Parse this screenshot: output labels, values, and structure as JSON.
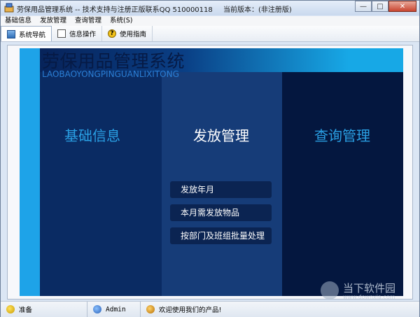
{
  "window": {
    "title": "劳保用品管理系统 -- 技术支持与注册正版联系QQ 510000118",
    "version": "当前版本：(非注册版)",
    "buttons": {
      "minimize": "—",
      "maximize": "□",
      "close": "✕"
    }
  },
  "menubar": {
    "items": [
      "基础信息",
      "发放管理",
      "查询管理",
      "系统(S)"
    ]
  },
  "toolbar": {
    "items": [
      {
        "label": "系统导航",
        "icon": "nav-icon"
      },
      {
        "label": "信息操作",
        "icon": "document-icon"
      },
      {
        "label": "使用指南",
        "icon": "help-icon"
      }
    ]
  },
  "main": {
    "brand_title": "劳保用品管理系统",
    "brand_subtitle": "LAOBAOYONGPINGUANLIXITONG",
    "columns": [
      {
        "title": "基础信息"
      },
      {
        "title": "发放管理"
      },
      {
        "title": "查询管理"
      }
    ],
    "submenu": [
      "发放年月",
      "本月需发放物品",
      "按部门及班组批量处理"
    ]
  },
  "status": {
    "state": "准备",
    "user": "Admin",
    "message": "欢迎使用我们的产品!"
  },
  "watermark": {
    "name": "当下软件园",
    "url": "www.downxia.com"
  },
  "colors": {
    "stage_bg": "#04173f",
    "accent_blue": "#2aa0e4",
    "light_strip": "#1ea3e8",
    "active_column": "#163c78"
  }
}
